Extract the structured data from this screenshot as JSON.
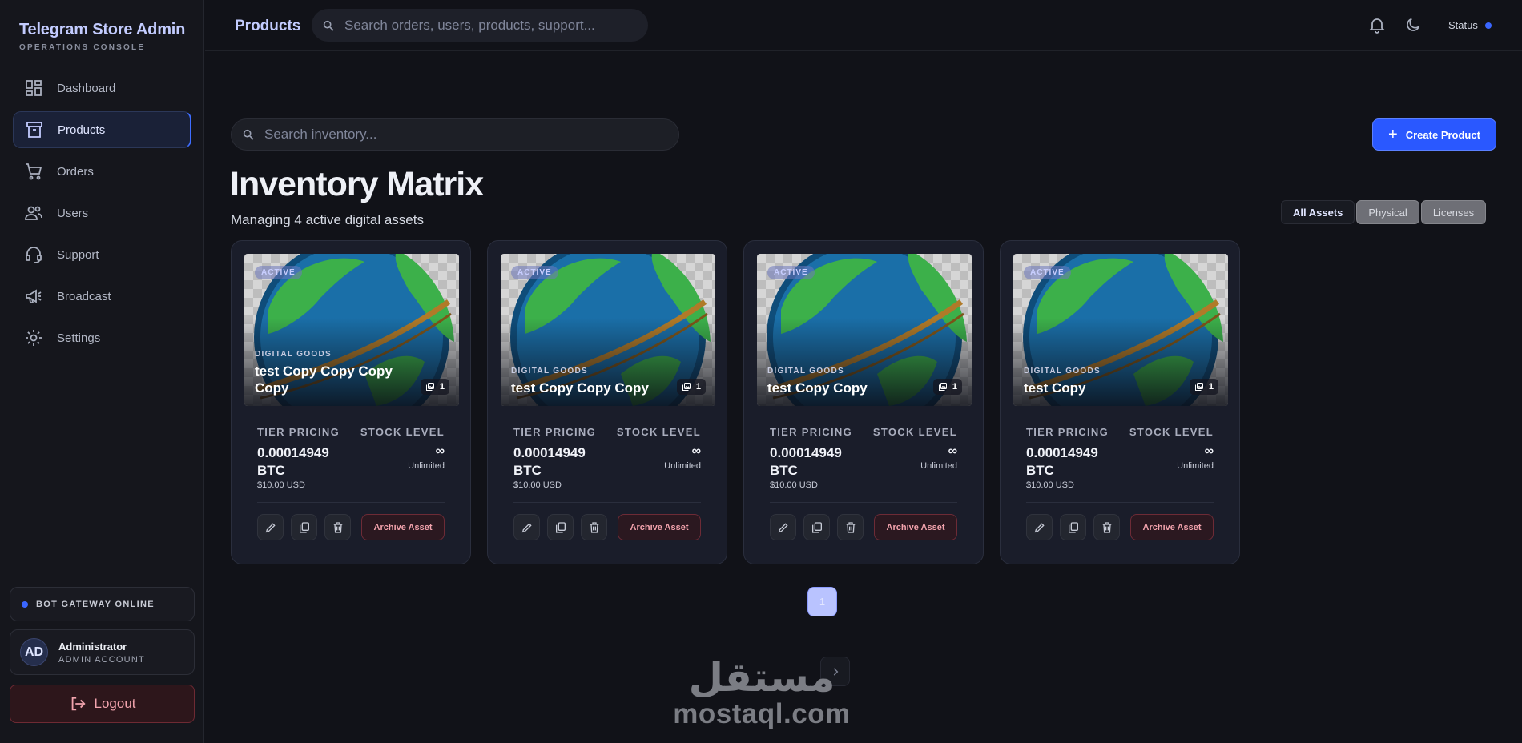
{
  "brand": {
    "title": "Telegram Store Admin",
    "subtitle": "OPERATIONS CONSOLE"
  },
  "nav": [
    {
      "label": "Dashboard",
      "icon": "dashboard-icon"
    },
    {
      "label": "Products",
      "icon": "archive-box-icon",
      "active": true
    },
    {
      "label": "Orders",
      "icon": "cart-icon"
    },
    {
      "label": "Users",
      "icon": "users-icon"
    },
    {
      "label": "Support",
      "icon": "headset-icon"
    },
    {
      "label": "Broadcast",
      "icon": "megaphone-icon"
    },
    {
      "label": "Settings",
      "icon": "gear-icon"
    }
  ],
  "gateway": {
    "label": "BOT GATEWAY ONLINE"
  },
  "account": {
    "initials": "AD",
    "name": "Administrator",
    "role": "ADMIN ACCOUNT"
  },
  "logout": {
    "label": "Logout"
  },
  "topbar": {
    "title": "Products",
    "search_placeholder": "Search orders, users, products, support...",
    "status_label": "Status"
  },
  "inventory": {
    "search_placeholder": "Search inventory...",
    "create_label": "Create Product",
    "title": "Inventory Matrix",
    "subtitle": "Managing 4 active digital assets",
    "filters": [
      "All Assets",
      "Physical",
      "Licenses"
    ]
  },
  "card_labels": {
    "badge": "ACTIVE",
    "category": "DIGITAL GOODS",
    "tier": "TIER PRICING",
    "stock": "STOCK LEVEL",
    "archive": "Archive Asset"
  },
  "products": [
    {
      "name": "test Copy Copy Copy Copy",
      "images": "1",
      "price": "0.00014949 BTC",
      "usd": "$10.00 USD",
      "stock_symbol": "∞",
      "stock_text": "Unlimited"
    },
    {
      "name": "test Copy Copy Copy",
      "images": "1",
      "price": "0.00014949 BTC",
      "usd": "$10.00 USD",
      "stock_symbol": "∞",
      "stock_text": "Unlimited"
    },
    {
      "name": "test Copy Copy",
      "images": "1",
      "price": "0.00014949 BTC",
      "usd": "$10.00 USD",
      "stock_symbol": "∞",
      "stock_text": "Unlimited"
    },
    {
      "name": "test Copy",
      "images": "1",
      "price": "0.00014949 BTC",
      "usd": "$10.00 USD",
      "stock_symbol": "∞",
      "stock_text": "Unlimited"
    }
  ],
  "pagination": {
    "current": "1"
  },
  "watermark": {
    "arabic": "مستقل",
    "latin": "mostaql.com"
  },
  "colors": {
    "accent": "#2a58ff",
    "danger": "#f3a3ad",
    "online": "#3a66ff"
  }
}
